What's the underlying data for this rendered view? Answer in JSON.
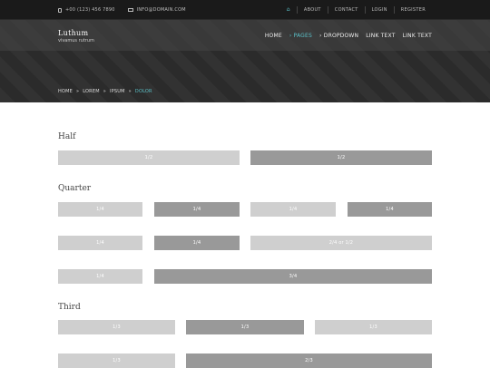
{
  "topbar": {
    "phone": "+00 (123) 456 7890",
    "email": "INFO@DOMAIN.COM",
    "links": [
      "ABOUT",
      "CONTACT",
      "LOGIN",
      "REGISTER"
    ]
  },
  "logo": {
    "title": "Luthum",
    "subtitle": "vivamus rutrum"
  },
  "nav": {
    "items": [
      "HOME",
      "› PAGES",
      "› DROPDOWN",
      "LINK TEXT",
      "LINK TEXT"
    ],
    "active_index": 1
  },
  "breadcrumb": [
    "HOME",
    "»",
    "LOREM",
    "»",
    "IPSUM",
    "»",
    "DOLOR"
  ],
  "sections": {
    "half": {
      "title": "Half",
      "rows": [
        [
          "1/2",
          "1/2"
        ]
      ]
    },
    "quarter": {
      "title": "Quarter",
      "rows": [
        [
          "1/4",
          "1/4",
          "1/4",
          "1/4"
        ],
        [
          "1/4",
          "1/4",
          "2/4 or 1/2"
        ],
        [
          "1/4",
          "3/4"
        ]
      ]
    },
    "third": {
      "title": "Third",
      "rows": [
        [
          "1/3",
          "1/3",
          "1/3"
        ],
        [
          "1/3",
          "2/3"
        ]
      ]
    }
  },
  "colors": {
    "accent": "#5bc0c8",
    "light_box": "#cfcfcf",
    "dark_box": "#999999",
    "topbar": "#1a1a1a"
  }
}
